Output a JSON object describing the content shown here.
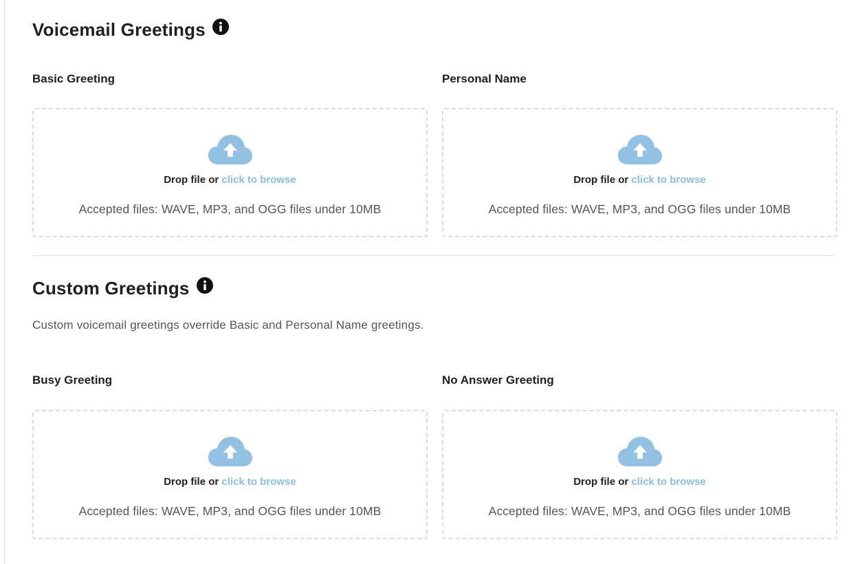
{
  "voicemail": {
    "title": "Voicemail Greetings",
    "info_icon": "info-circle-icon",
    "slots": [
      {
        "label": "Basic Greeting",
        "drop_prefix": "Drop file or",
        "browse_link": "click to browse",
        "accepted": "Accepted files: WAVE, MP3, and OGG files under 10MB"
      },
      {
        "label": "Personal Name",
        "drop_prefix": "Drop file or",
        "browse_link": "click to browse",
        "accepted": "Accepted files: WAVE, MP3, and OGG files under 10MB"
      }
    ]
  },
  "custom": {
    "title": "Custom Greetings",
    "info_icon": "info-circle-icon",
    "description": "Custom voicemail greetings override Basic and Personal Name greetings.",
    "slots": [
      {
        "label": "Busy Greeting",
        "drop_prefix": "Drop file or",
        "browse_link": "click to browse",
        "accepted": "Accepted files: WAVE, MP3, and OGG files under 10MB"
      },
      {
        "label": "No Answer Greeting",
        "drop_prefix": "Drop file or",
        "browse_link": "click to browse",
        "accepted": "Accepted files: WAVE, MP3, and OGG files under 10MB"
      }
    ]
  },
  "colors": {
    "upload_icon": "#93c1e3",
    "link": "#8dbde0",
    "dropzone_border": "#dcdcdc"
  },
  "icons": {
    "upload": "cloud-upload-icon",
    "info": "info-circle-icon"
  }
}
